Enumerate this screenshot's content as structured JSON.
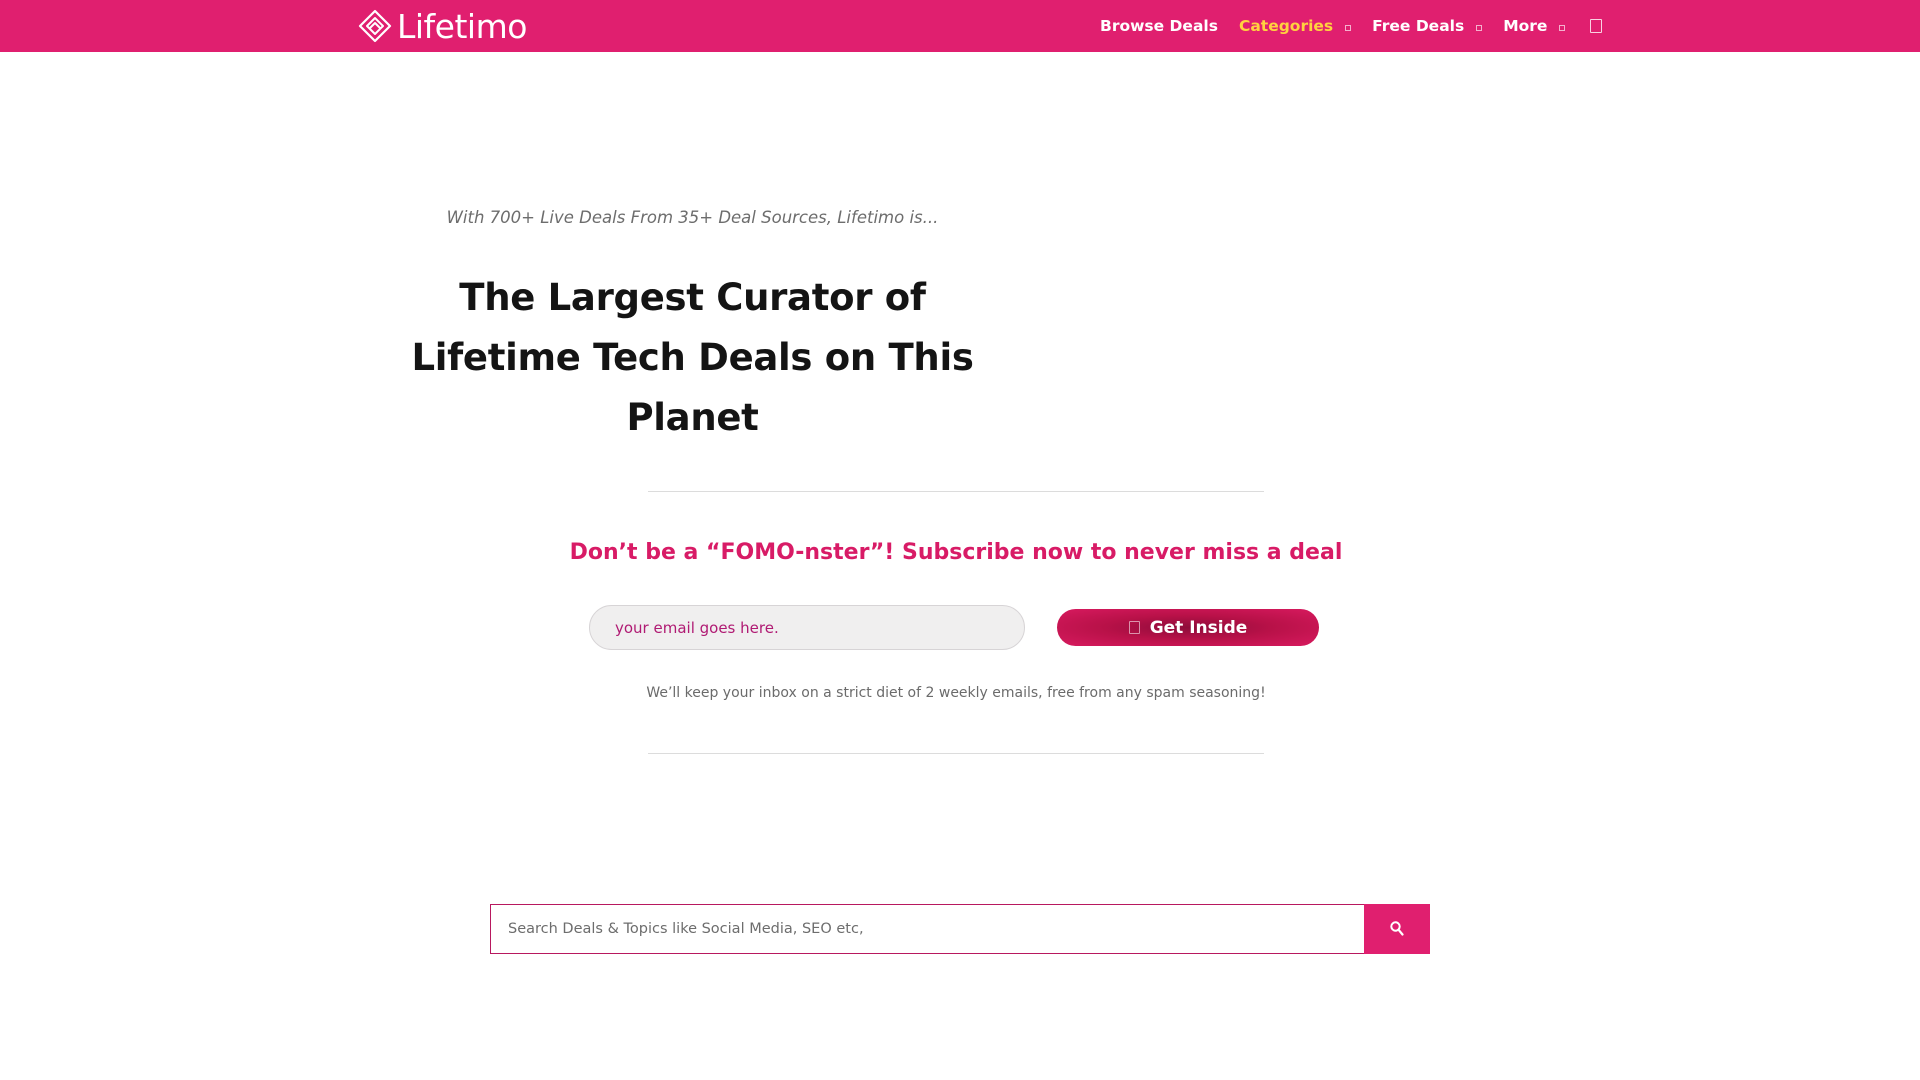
{
  "header": {
    "brand": "Lifetimo",
    "nav": [
      {
        "label": "Browse Deals",
        "has_dropdown": false,
        "active": false
      },
      {
        "label": "Categories",
        "has_dropdown": true,
        "active": true
      },
      {
        "label": "Free Deals",
        "has_dropdown": true,
        "active": false
      },
      {
        "label": "More",
        "has_dropdown": true,
        "active": false
      }
    ],
    "icons": {
      "logo": "diamond-logo-icon",
      "dropdown": "chevron-down-icon",
      "extra": "square-icon"
    }
  },
  "hero": {
    "tagline": "With 700+ Live Deals From 35+ Deal Sources, Lifetimo is...",
    "headline": "The Largest Curator of Lifetime Tech Deals on This Planet"
  },
  "subscribe": {
    "title": "Don’t be a “FOMO-nster”! Subscribe now to never miss a deal",
    "email_placeholder": "your email goes here.",
    "button_label": "Get Inside",
    "note": "We’ll keep your inbox on a strict diet of 2 weekly emails, free from any spam seasoning!"
  },
  "search": {
    "placeholder": "Search Deals & Topics like Social Media, SEO etc,",
    "button_icon": "search-icon"
  },
  "colors": {
    "brand": "#e01f6f",
    "nav_active": "#ffd23f",
    "subscribe_title": "#d81b66"
  }
}
